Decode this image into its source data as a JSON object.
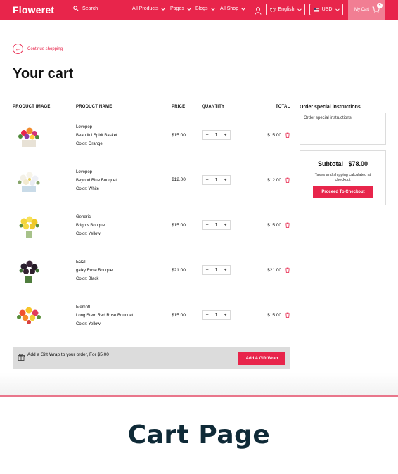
{
  "header": {
    "logo": "Floweret",
    "search_label": "Search",
    "nav": [
      {
        "label": "All Products"
      },
      {
        "label": "Pages"
      },
      {
        "label": "Blogs"
      },
      {
        "label": "All Shop"
      }
    ],
    "language": "English",
    "currency": "USD",
    "cart_label": "My Cart",
    "cart_count": "5"
  },
  "back_link": "Continue shopping",
  "page_title": "Your cart",
  "table_headers": {
    "image": "PRODUCT IMAGE",
    "name": "PRODUCT NAME",
    "price": "PRICE",
    "quantity": "QUANTITY",
    "total": "TOTAL"
  },
  "items": [
    {
      "vendor": "Lovepop",
      "name": "Beautiful Spirit Basket",
      "variant": "Color: Orange",
      "price": "$15.00",
      "qty": "1",
      "total": "$15.00"
    },
    {
      "vendor": "Lovepop",
      "name": "Beyond Blue Bouquet",
      "variant": "Color: White",
      "price": "$12.00",
      "qty": "1",
      "total": "$12.00"
    },
    {
      "vendor": "Generic",
      "name": "Brights Bouquet",
      "variant": "Color: Yellow",
      "price": "$15.00",
      "qty": "1",
      "total": "$15.00"
    },
    {
      "vendor": "EG2I",
      "name": "galxy Rose Bouquet",
      "variant": "Color: Black",
      "price": "$21.00",
      "qty": "1",
      "total": "$21.00"
    },
    {
      "vendor": "Elemntl",
      "name": "Long Stem Red Rose Bouquet",
      "variant": "Color: Yellow",
      "price": "$15.00",
      "qty": "1",
      "total": "$15.00"
    }
  ],
  "qty_minus": "−",
  "qty_plus": "+",
  "gift_wrap": {
    "text": "Add a Gift Wrap to your order, For $5.00",
    "button": "Add A Gift Wrap"
  },
  "instructions": {
    "title": "Order special instructions",
    "placeholder": "Order special instructions"
  },
  "summary": {
    "subtotal_label": "Subtotal",
    "subtotal_value": "$78.00",
    "taxes_note": "Taxes and shipping calculated at checkout",
    "checkout_button": "Proceed To Checkout"
  },
  "bottom_title": "Cart Page",
  "colors": {
    "brand": "#e8254b",
    "brand_light": "#f17e93",
    "dark_title": "#0f2a37"
  }
}
